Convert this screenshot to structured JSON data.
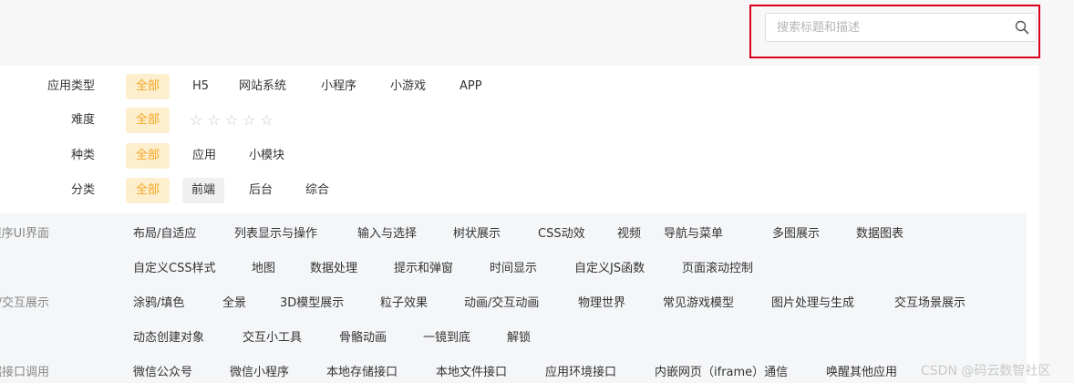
{
  "search": {
    "placeholder": "搜索标题和描述"
  },
  "filters": {
    "app_type": {
      "label": "应用类型",
      "options": [
        "全部",
        "H5",
        "网站系统",
        "小程序",
        "小游戏",
        "APP"
      ]
    },
    "difficulty": {
      "label": "难度",
      "options": [
        "全部"
      ],
      "stars": 5,
      "rating": 0
    },
    "kind": {
      "label": "种类",
      "options": [
        "全部",
        "应用",
        "小模块"
      ]
    },
    "category": {
      "label": "分类",
      "options": [
        "全部",
        "前端",
        "后台",
        "综合"
      ]
    }
  },
  "categories": [
    {
      "label": "用/小程序UI界面",
      "items": [
        "布局/自适应",
        "列表显示与操作",
        "输入与选择",
        "树状展示",
        "CSS动效",
        "视频",
        "导航与菜单",
        "多图展示",
        "数据图表",
        "自定义CSS样式",
        "地图",
        "数据处理",
        "提示和弹窗",
        "时间显示",
        "自定义JS函数",
        "页面滚动控制"
      ]
    },
    {
      "label": "画/游戏/交互展示",
      "items": [
        "涂鸦/填色",
        "全景",
        "3D模型展示",
        "粒子效果",
        "动画/交互动画",
        "物理世界",
        "常见游戏模型",
        "图片处理与生成",
        "交互场景展示",
        "动态创建对象",
        "交互小工具",
        "骨骼动画",
        "一镜到底",
        "解锁"
      ]
    },
    {
      "label": "客户端接口调用",
      "items": [
        "微信公众号",
        "微信小程序",
        "本地存储接口",
        "本地文件接口",
        "应用环境接口",
        "内嵌网页（iframe）通信",
        "唤醒其他应用"
      ]
    }
  ],
  "watermark": "CSDN @码云数智社区",
  "colors": {
    "active_bg": "#fdeecd",
    "active_text": "#f5a623",
    "highlight_border": "#d9001b"
  }
}
